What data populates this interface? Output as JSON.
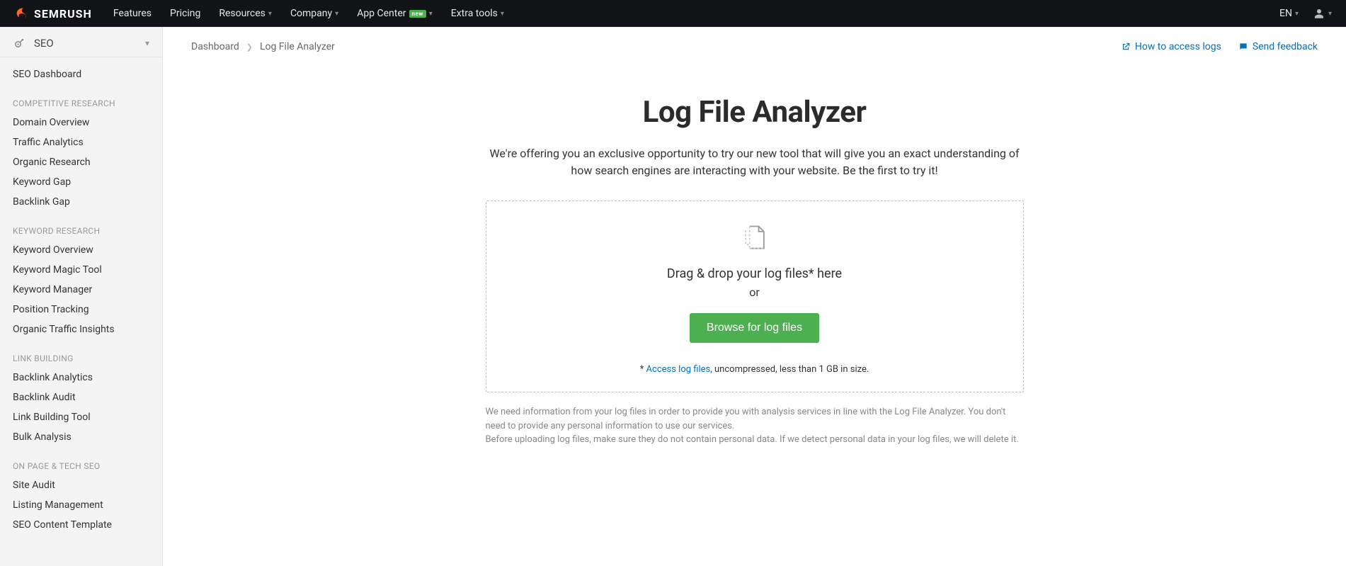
{
  "brand": {
    "name": "SEMRUSH"
  },
  "topnav": {
    "features": "Features",
    "pricing": "Pricing",
    "resources": "Resources",
    "company": "Company",
    "appcenter": "App Center",
    "appcenter_badge": "new",
    "extratools": "Extra tools"
  },
  "topright": {
    "lang": "EN"
  },
  "sidebar": {
    "head_title": "SEO",
    "dashboard": "SEO Dashboard",
    "sections": {
      "competitive": {
        "title": "COMPETITIVE RESEARCH",
        "items": [
          "Domain Overview",
          "Traffic Analytics",
          "Organic Research",
          "Keyword Gap",
          "Backlink Gap"
        ]
      },
      "keyword": {
        "title": "KEYWORD RESEARCH",
        "items": [
          "Keyword Overview",
          "Keyword Magic Tool",
          "Keyword Manager",
          "Position Tracking",
          "Organic Traffic Insights"
        ]
      },
      "link": {
        "title": "LINK BUILDING",
        "items": [
          "Backlink Analytics",
          "Backlink Audit",
          "Link Building Tool",
          "Bulk Analysis"
        ]
      },
      "onpage": {
        "title": "ON PAGE & TECH SEO",
        "items": [
          "Site Audit",
          "Listing Management",
          "SEO Content Template"
        ]
      }
    }
  },
  "breadcrumb": {
    "dashboard": "Dashboard",
    "current": "Log File Analyzer"
  },
  "toplinks": {
    "howto": "How to access logs",
    "feedback": "Send feedback"
  },
  "hero": {
    "title": "Log File Analyzer",
    "subtitle": "We're offering you an exclusive opportunity to try our new tool that will give you an exact understanding of how search engines are interacting with your website. Be the first to try it!"
  },
  "dropzone": {
    "drag_text": "Drag & drop your log files* here",
    "or": "or",
    "browse": "Browse for log files",
    "note_prefix": "* ",
    "note_link": "Access log files",
    "note_suffix": ", uncompressed, less than 1 GB in size."
  },
  "disclaimer": {
    "line1": "We need information from your log files in order to provide you with analysis services in line with the Log File Analyzer. You don't need to provide any personal information to use our services.",
    "line2": "Before uploading log files, make sure they do not contain personal data. If we detect personal data in your log files, we will delete it."
  }
}
